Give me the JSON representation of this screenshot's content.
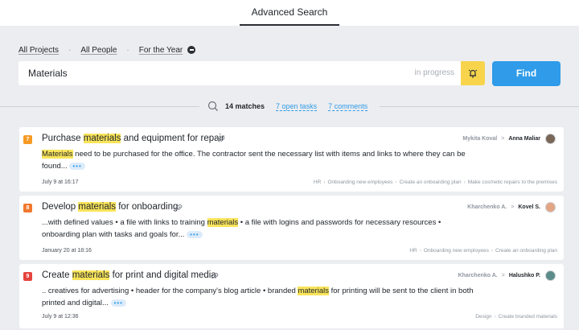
{
  "header": {
    "tab": "Advanced Search"
  },
  "filters": [
    {
      "label": "All Projects"
    },
    {
      "label": "All People"
    },
    {
      "label": "For the Year"
    }
  ],
  "search": {
    "value": "Materials",
    "status": "in progress",
    "find_label": "Find"
  },
  "summary": {
    "matches": "14 matches",
    "open_tasks": "7 open tasks",
    "comments": "7 comments"
  },
  "results": [
    {
      "number": "7",
      "badge_color": "#f59a23",
      "title_before": "Purchase ",
      "title_hl": "materials",
      "title_after": " and equipment for repair",
      "from": "Mykita Koval",
      "to": "Anna Maliar",
      "snippet_hl": "Materials",
      "snippet_after": " need to be purchased for the office. The contractor sent the necessary list with items and links to where they can be found...",
      "more": "•••",
      "date": "July 9 at 16:17",
      "crumbs": [
        "HR",
        "Onboarding new employees",
        "Create an onboarding plan",
        "Make cosmetic repairs to the premises"
      ]
    },
    {
      "number": "8",
      "badge_color": "#f0782d",
      "title_before": "Develop ",
      "title_hl": "materials",
      "title_after": " for onboarding",
      "from": "Kharchenko A.",
      "to": "Kovel S.",
      "snippet_before": "...with defined values • a file with links to training ",
      "snippet_hl": "materials",
      "snippet_after": " • a file with logins and passwords for necessary resources • onboarding plan with tasks and goals for...",
      "more": "•••",
      "date": "January 20 at 18:16",
      "crumbs": [
        "HR",
        "Onboarding new employees",
        "Create an onboarding plan"
      ]
    },
    {
      "number": "9",
      "badge_color": "#e5433d",
      "title_before": "Create ",
      "title_hl": "materials",
      "title_after": " for print and digital media",
      "from": "Kharchenko A.",
      "to": "Halushko P.",
      "snippet_before": ".. creatives for advertising • header for the company's blog article • branded ",
      "snippet_hl": "materials",
      "snippet_after": " for printing will be sent to the client in both printed and digital...",
      "more": "•••",
      "date": "July 9 at 12:36",
      "crumbs": [
        "Design",
        "Create branded materials"
      ]
    }
  ]
}
